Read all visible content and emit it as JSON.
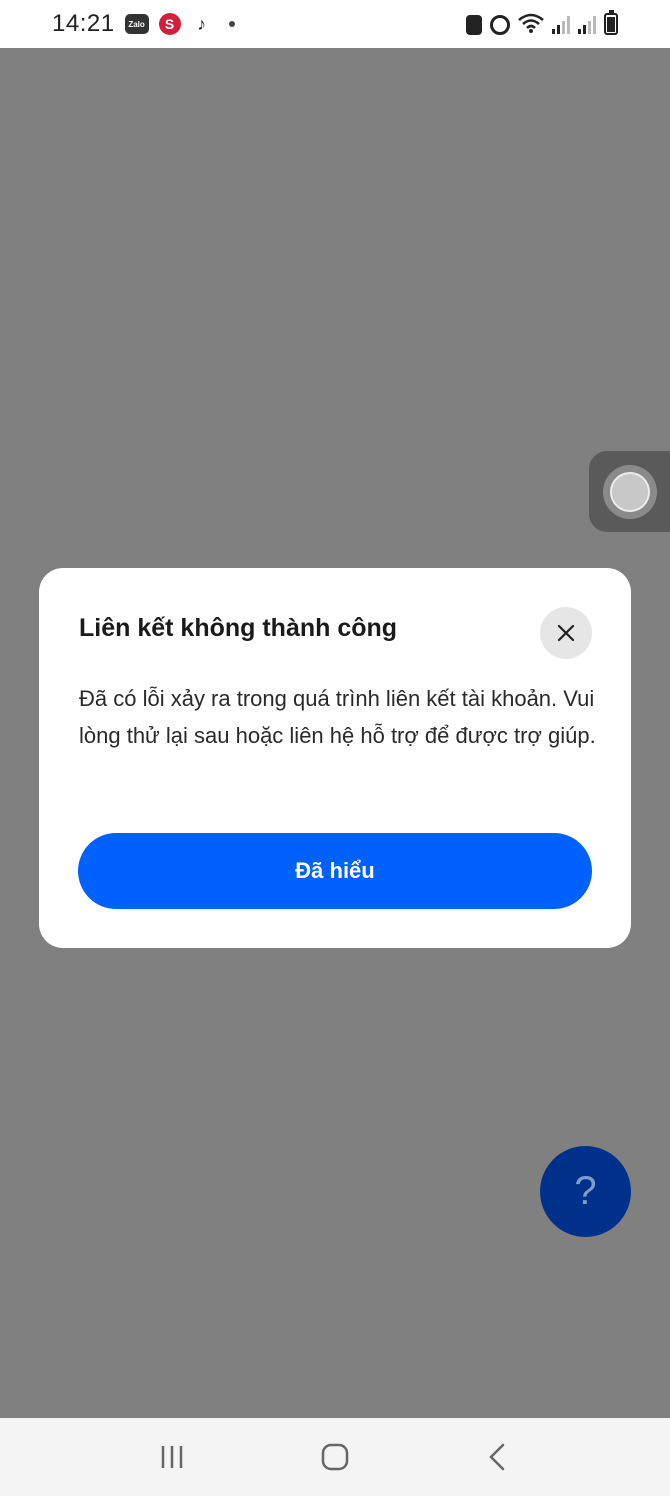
{
  "status_bar": {
    "time": "14:21",
    "app_icons": [
      "zalo-icon",
      "s-app-icon",
      "tiktok-icon"
    ],
    "zalo_label": "Zalo",
    "status_icons": [
      "notification-badge-icon",
      "alarm-icon",
      "wifi-icon",
      "signal-icon",
      "signal-icon",
      "battery-icon"
    ]
  },
  "dialog": {
    "title": "Liên kết không thành công",
    "message": "Đã có lỗi xảy ra trong quá trình liên kết tài khoản. Vui lòng thử lại sau hoặc liên hệ hỗ trợ để được trợ giúp.",
    "confirm_label": "Đã hiểu",
    "close_icon": "close-icon"
  },
  "help_fab": {
    "label": "?"
  },
  "nav_bar": {
    "items": [
      "recent-apps-icon",
      "home-icon",
      "back-icon"
    ]
  },
  "colors": {
    "overlay": "#808080",
    "primary": "#0061ff",
    "fab": "#00318a",
    "dialog_bg": "#ffffff"
  }
}
